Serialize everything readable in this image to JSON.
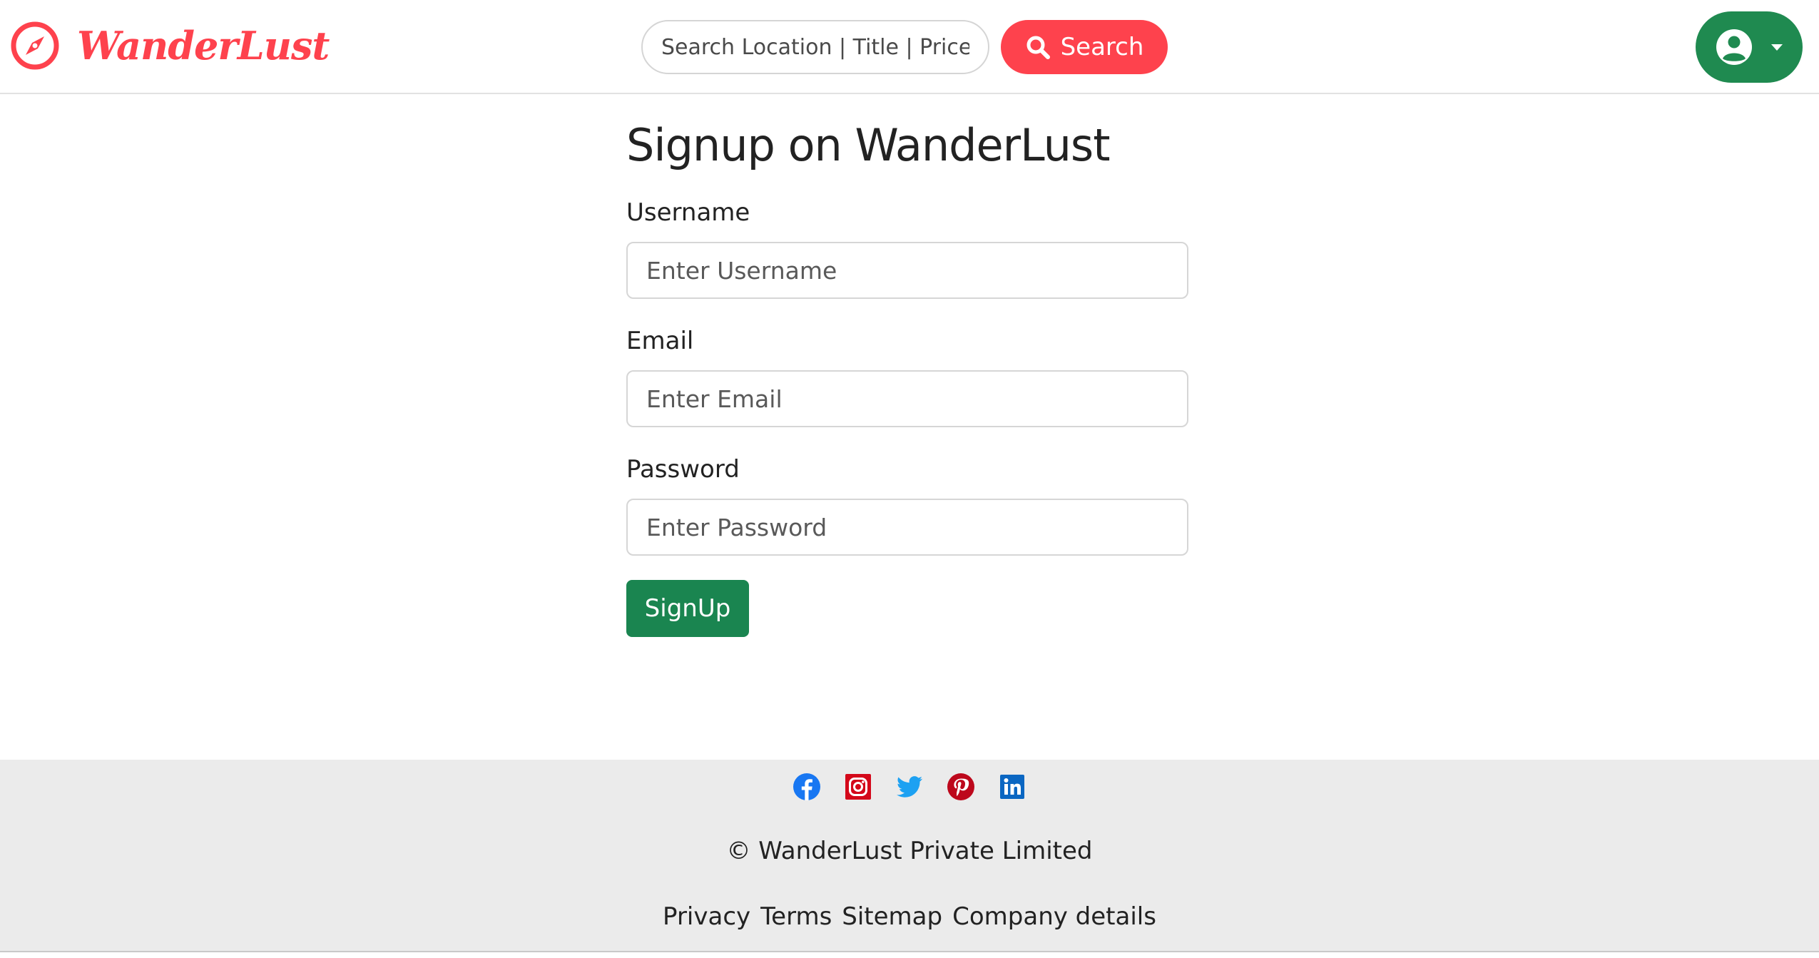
{
  "navbar": {
    "brand_name": "WanderLust",
    "brand_icon": "compass-icon",
    "search_placeholder": "Search Location | Title | Price",
    "search_button_label": "Search",
    "search_icon": "search-icon",
    "user_menu_icon": "user-circle-icon",
    "accent_color": "#fe424d"
  },
  "form": {
    "title": "Signup on WanderLust",
    "username_label": "Username",
    "username_placeholder": "Enter Username",
    "email_label": "Email",
    "email_placeholder": "Enter Email",
    "password_label": "Password",
    "password_placeholder": "Enter Password",
    "submit_label": "SignUp",
    "submit_color": "#1a8550"
  },
  "footer": {
    "socials": [
      "facebook-icon",
      "instagram-icon",
      "twitter-icon",
      "pinterest-icon",
      "linkedin-icon"
    ],
    "copyright": "© WanderLust Private Limited",
    "links": {
      "privacy": "Privacy",
      "terms": "Terms",
      "sitemap": "Sitemap",
      "company_details": "Company details"
    },
    "background": "#ebebeb"
  }
}
